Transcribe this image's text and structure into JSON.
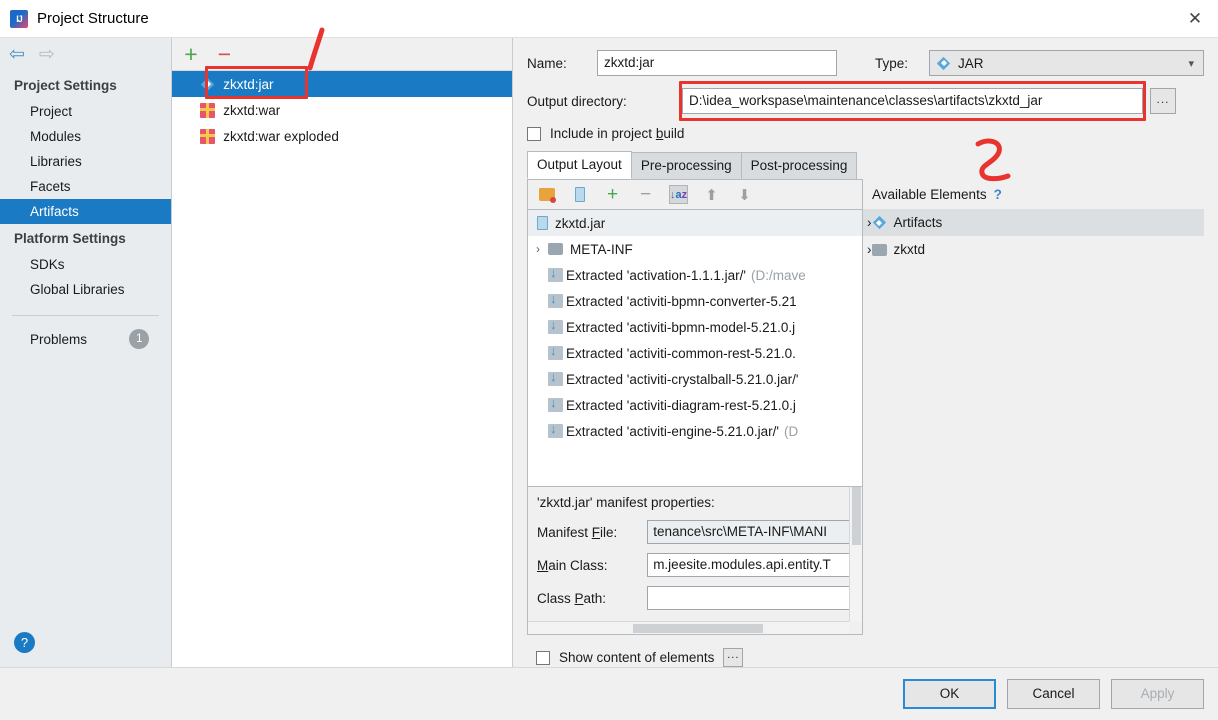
{
  "window": {
    "title": "Project Structure",
    "app_icon": "intellij-idea-icon",
    "close_label": "✕"
  },
  "nav": {
    "back_icon": "arrow-left-icon",
    "forward_icon": "arrow-right-icon"
  },
  "sidebar": {
    "sections": [
      {
        "header": "Project Settings",
        "items": [
          {
            "label": "Project",
            "selected": false
          },
          {
            "label": "Modules",
            "selected": false
          },
          {
            "label": "Libraries",
            "selected": false
          },
          {
            "label": "Facets",
            "selected": false
          },
          {
            "label": "Artifacts",
            "selected": true
          }
        ]
      },
      {
        "header": "Platform Settings",
        "items": [
          {
            "label": "SDKs",
            "selected": false
          },
          {
            "label": "Global Libraries",
            "selected": false
          }
        ]
      }
    ],
    "problems": {
      "label": "Problems",
      "count": "1"
    },
    "help_label": "?"
  },
  "artifacts_panel": {
    "toolbar": {
      "add": "+",
      "remove": "−"
    },
    "items": [
      {
        "label": "zkxtd:jar",
        "icon": "jar-artifact-icon",
        "selected": true
      },
      {
        "label": "zkxtd:war",
        "icon": "war-artifact-icon",
        "selected": false
      },
      {
        "label": "zkxtd:war exploded",
        "icon": "war-artifact-icon",
        "selected": false
      }
    ]
  },
  "detail": {
    "name_label": "Name:",
    "name_value": "zkxtd:jar",
    "type_label": "Type:",
    "type_value": "JAR",
    "type_icon": "jar-artifact-icon",
    "output_dir_label": "Output directory:",
    "output_dir_value": "D:\\idea_workspase\\maintenance\\classes\\artifacts\\zkxtd_jar",
    "browse_label": "...",
    "include_in_build_label": "Include in project build",
    "include_in_build_checked": false,
    "tabs": [
      {
        "label": "Output Layout",
        "active": true
      },
      {
        "label": "Pre-processing",
        "active": false
      },
      {
        "label": "Post-processing",
        "active": false
      }
    ],
    "layout_toolbar": [
      {
        "name": "create-directory-icon",
        "pressed": false
      },
      {
        "name": "create-archive-icon",
        "pressed": false
      },
      {
        "name": "add-icon",
        "pressed": false
      },
      {
        "name": "remove-icon",
        "pressed": false
      },
      {
        "name": "sort-alphabetically-icon",
        "pressed": true
      },
      {
        "name": "move-up-icon",
        "pressed": false
      },
      {
        "name": "move-down-icon",
        "pressed": false
      }
    ],
    "tree": {
      "root": {
        "label": "zkxtd.jar",
        "icon": "jar-file-icon"
      },
      "nodes": [
        {
          "label": "META-INF",
          "icon": "folder-icon",
          "twisty": "›",
          "hint": ""
        },
        {
          "label": "Extracted 'activation-1.1.1.jar/'",
          "icon": "extracted-jar-icon",
          "twisty": "",
          "hint": "(D:/mave"
        },
        {
          "label": "Extracted 'activiti-bpmn-converter-5.21",
          "icon": "extracted-jar-icon",
          "twisty": "",
          "hint": ""
        },
        {
          "label": "Extracted 'activiti-bpmn-model-5.21.0.j",
          "icon": "extracted-jar-icon",
          "twisty": "",
          "hint": ""
        },
        {
          "label": "Extracted 'activiti-common-rest-5.21.0.",
          "icon": "extracted-jar-icon",
          "twisty": "",
          "hint": ""
        },
        {
          "label": "Extracted 'activiti-crystalball-5.21.0.jar/'",
          "icon": "extracted-jar-icon",
          "twisty": "",
          "hint": ""
        },
        {
          "label": "Extracted 'activiti-diagram-rest-5.21.0.j",
          "icon": "extracted-jar-icon",
          "twisty": "",
          "hint": ""
        },
        {
          "label": "Extracted 'activiti-engine-5.21.0.jar/'",
          "icon": "extracted-jar-icon",
          "twisty": "",
          "hint": "(D"
        }
      ]
    },
    "available_elements": {
      "title": "Available Elements",
      "help": "?",
      "items": [
        {
          "label": "Artifacts",
          "icon": "jar-artifact-icon",
          "twisty": "›",
          "selected": true
        },
        {
          "label": "zkxtd",
          "icon": "module-folder-icon",
          "twisty": "›",
          "selected": false
        }
      ]
    },
    "manifest": {
      "title": "'zkxtd.jar' manifest properties:",
      "rows": [
        {
          "label": "Manifest File:",
          "value": "tenance\\src\\META-INF\\MANI"
        },
        {
          "label": "Main Class:",
          "value": "m.jeesite.modules.api.entity.T"
        },
        {
          "label": "Class Path:",
          "value": ""
        }
      ]
    },
    "show_content_label": "Show content of elements",
    "show_content_checked": false,
    "show_content_dots": "..."
  },
  "footer": {
    "ok": "OK",
    "cancel": "Cancel",
    "apply": "Apply",
    "apply_disabled": true
  },
  "annotations": [
    {
      "name": "annotation-1",
      "text": "1",
      "color": "#e8332f"
    },
    {
      "name": "annotation-2",
      "text": "2",
      "color": "#e8332f"
    }
  ],
  "colors": {
    "accent": "#1a7bc4",
    "annotation_red": "#e8332f",
    "sidebar_bg": "#e8ecef"
  }
}
